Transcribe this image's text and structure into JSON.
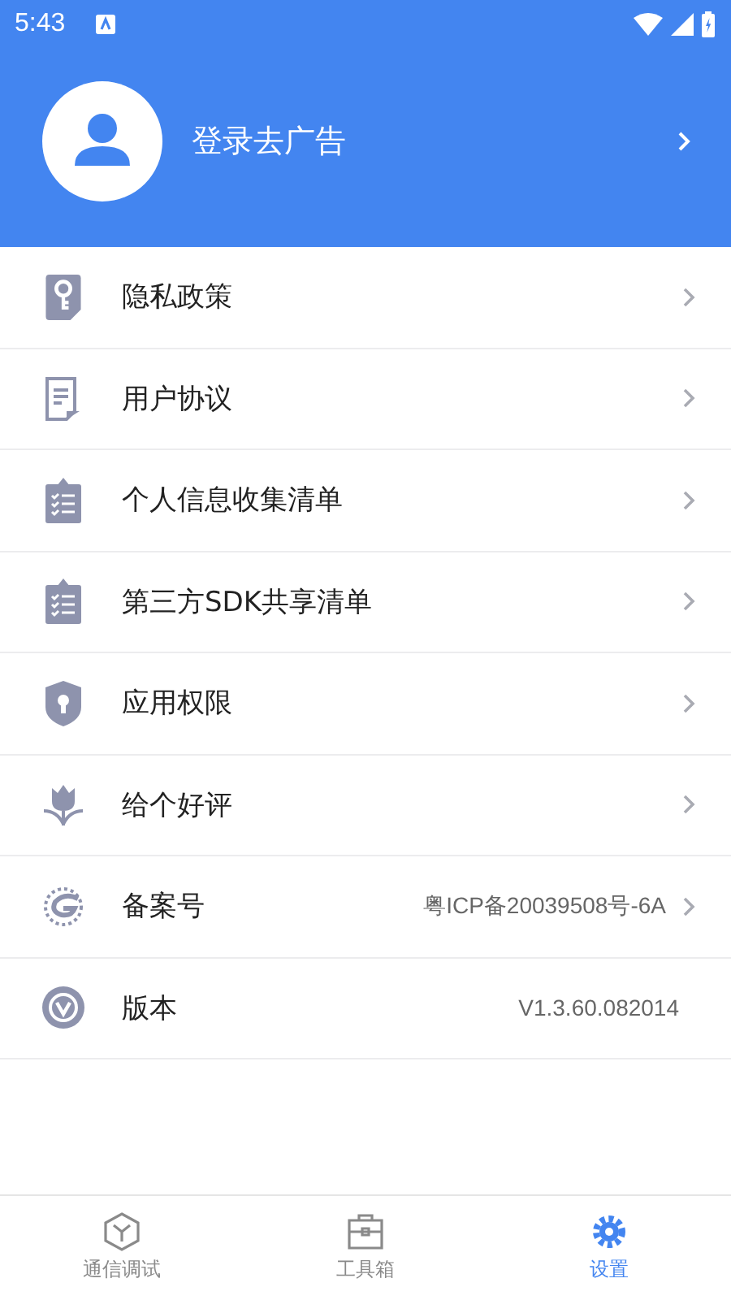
{
  "status_bar": {
    "time": "5:43"
  },
  "header": {
    "login_label": "登录去广告"
  },
  "menu": [
    {
      "label": "隐私政策",
      "chevron": true
    },
    {
      "label": "用户协议",
      "chevron": true
    },
    {
      "label": "个人信息收集清单",
      "chevron": true
    },
    {
      "label": "第三方SDK共享清单",
      "chevron": true
    },
    {
      "label": "应用权限",
      "chevron": true
    },
    {
      "label": "给个好评",
      "chevron": true
    },
    {
      "label": "备案号",
      "value": "粤ICP备20039508号-6A",
      "chevron": true
    },
    {
      "label": "版本",
      "value": "V1.3.60.082014",
      "chevron": false
    }
  ],
  "tabs": [
    {
      "label": "通信调试",
      "selected": false
    },
    {
      "label": "工具箱",
      "selected": false
    },
    {
      "label": "设置",
      "selected": true
    }
  ]
}
